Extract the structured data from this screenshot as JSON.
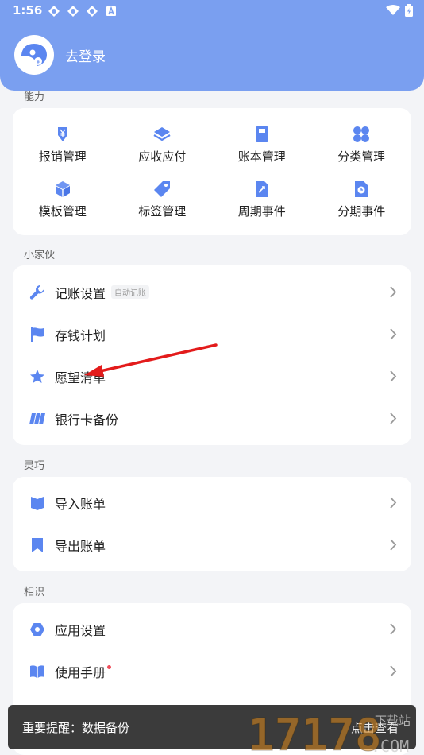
{
  "status": {
    "time": "1:56"
  },
  "profile": {
    "login_text": "去登录"
  },
  "sections": {
    "ability": "能力",
    "gadgets": "小家伙",
    "smart": "灵巧",
    "acquaint": "相识"
  },
  "ability_items": [
    {
      "label": "报销管理",
      "icon": "expense-icon"
    },
    {
      "label": "应收应付",
      "icon": "layers-icon"
    },
    {
      "label": "账本管理",
      "icon": "book-icon"
    },
    {
      "label": "分类管理",
      "icon": "category-icon"
    },
    {
      "label": "模板管理",
      "icon": "cube-icon"
    },
    {
      "label": "标签管理",
      "icon": "tag-icon"
    },
    {
      "label": "周期事件",
      "icon": "cycle-icon"
    },
    {
      "label": "分期事件",
      "icon": "installment-icon"
    }
  ],
  "gadget_items": [
    {
      "label": "记账设置",
      "badge": "自动记账",
      "icon": "wrench-icon"
    },
    {
      "label": "存钱计划",
      "icon": "flag-icon"
    },
    {
      "label": "愿望清单",
      "icon": "star-icon"
    },
    {
      "label": "银行卡备份",
      "icon": "card-icon"
    }
  ],
  "smart_items": [
    {
      "label": "导入账单",
      "icon": "import-icon"
    },
    {
      "label": "导出账单",
      "icon": "export-icon"
    }
  ],
  "acquaint_items": [
    {
      "label": "应用设置",
      "icon": "settings-icon"
    },
    {
      "label": "使用手册",
      "icon": "manual-icon"
    }
  ],
  "toast": {
    "message": "重要提醒：数据备份",
    "action": "点击查看"
  },
  "watermark": {
    "text": "17178",
    "suffix": ".COM",
    "caption": "下载站"
  },
  "colors": {
    "header": "#7a9ff0",
    "icon": "#5b86f0",
    "accent_red": "#ef4d5a"
  }
}
